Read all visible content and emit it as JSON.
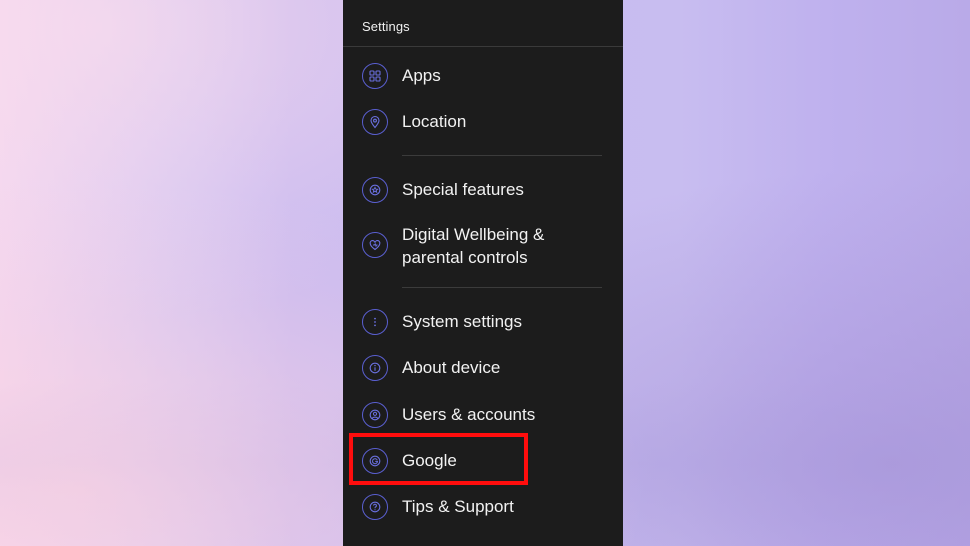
{
  "settings": {
    "title": "Settings",
    "items": [
      {
        "label": "Apps",
        "icon": "apps-icon"
      },
      {
        "label": "Location",
        "icon": "location-icon"
      },
      {
        "label": "Special features",
        "icon": "star-icon"
      },
      {
        "label_line1": "Digital Wellbeing &",
        "label_line2": "parental controls",
        "icon": "heart-icon"
      },
      {
        "label": "System settings",
        "icon": "more-vertical-icon"
      },
      {
        "label": "About device",
        "icon": "info-icon"
      },
      {
        "label": "Users & accounts",
        "icon": "user-icon"
      },
      {
        "label": "Google",
        "icon": "google-icon"
      },
      {
        "label": "Tips & Support",
        "icon": "help-icon"
      }
    ]
  },
  "colors": {
    "panel_bg": "#1c1c1c",
    "icon_accent": "#5a5fd0",
    "highlight": "#ff0d0d"
  }
}
